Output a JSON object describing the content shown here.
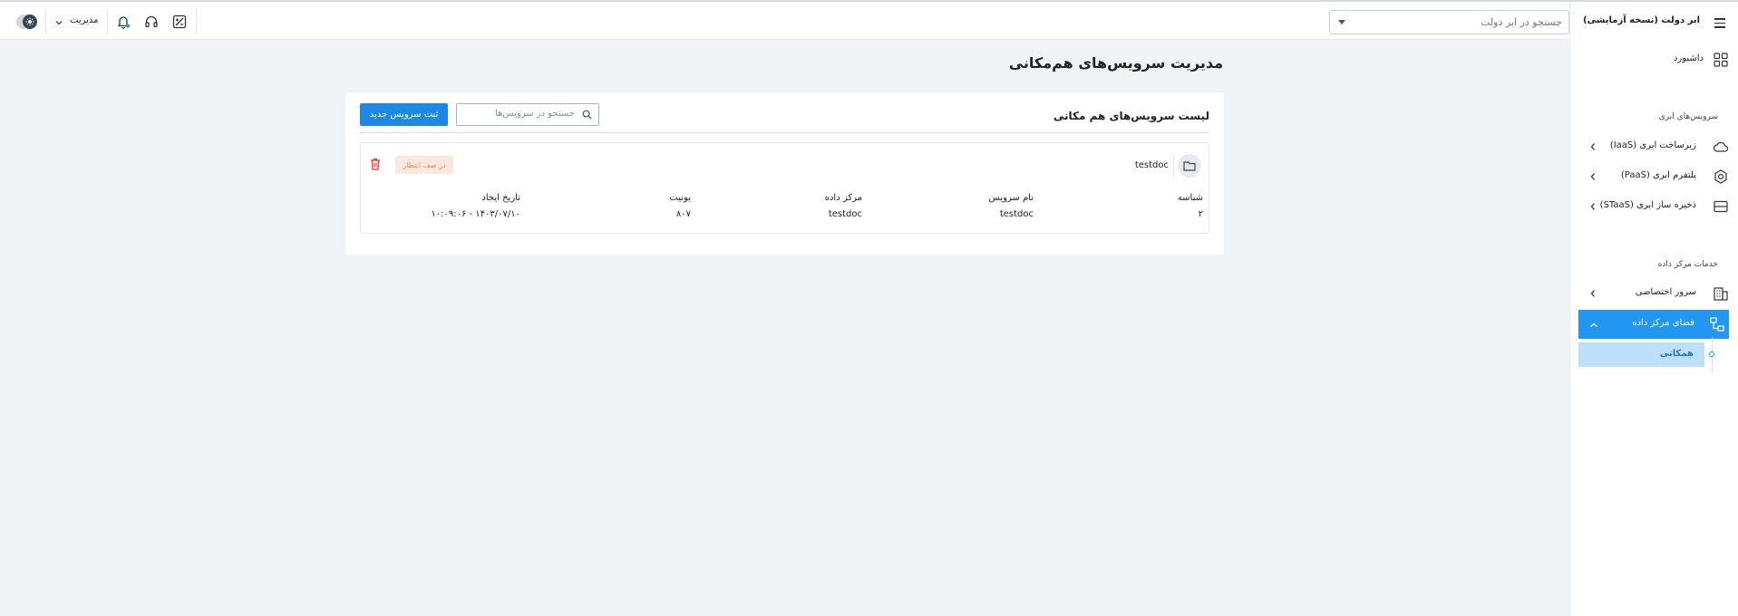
{
  "app": {
    "brand": "ابر دولت (نسخه آزمایشی)"
  },
  "header": {
    "search_placeholder": "جستجو در ابر دولت",
    "role_label": "مدیریت"
  },
  "sidebar": {
    "dashboard": "داشبورد",
    "section_cloud": "سرویس‌های ابری",
    "cloud_items": [
      {
        "label": "زیرساخت ابری (IaaS)",
        "icon": "cloud-icon"
      },
      {
        "label": "پلتفرم ابری (PaaS)",
        "icon": "hexagon-gear-icon"
      },
      {
        "label": "ذخیره ساز ابری (STaaS)",
        "icon": "storage-icon"
      }
    ],
    "section_dc": "خدمات مرکز داده",
    "dc_items": [
      {
        "label": "سرور اختصاصی",
        "icon": "building-icon"
      },
      {
        "label": "فضای مرکز داده",
        "icon": "network-icon",
        "active": true
      }
    ],
    "sub_item": "همکانی"
  },
  "main": {
    "page_title": "مدیریت سرویس‌های هم‌مکانی",
    "card_title": "لیست سرویس‌های هم مکانی",
    "search_placeholder": "جستجو در سرویس‌ها",
    "new_button": "ثبت سرویس جدید",
    "item": {
      "name": "testdoc",
      "status": "در صف انتظار",
      "columns": [
        {
          "header": "شناسه",
          "value": "۲"
        },
        {
          "header": "نام سرویس",
          "value": "testdoc"
        },
        {
          "header": "مرکز داده",
          "value": "testdoc"
        },
        {
          "header": "یونیت",
          "value": "۸۰۷"
        },
        {
          "header": "تاریخ ایجاد",
          "value": "۱۴۰۳/۰۷/۱۰ - ۱۰:۰۹:۰۶"
        }
      ]
    }
  },
  "colors": {
    "primary": "#2196f3",
    "button": "#1e88e5",
    "badge_bg": "#fde8df",
    "badge_text": "#e98a5d",
    "danger": "#e53935",
    "page_bg": "#f1f4f7"
  }
}
